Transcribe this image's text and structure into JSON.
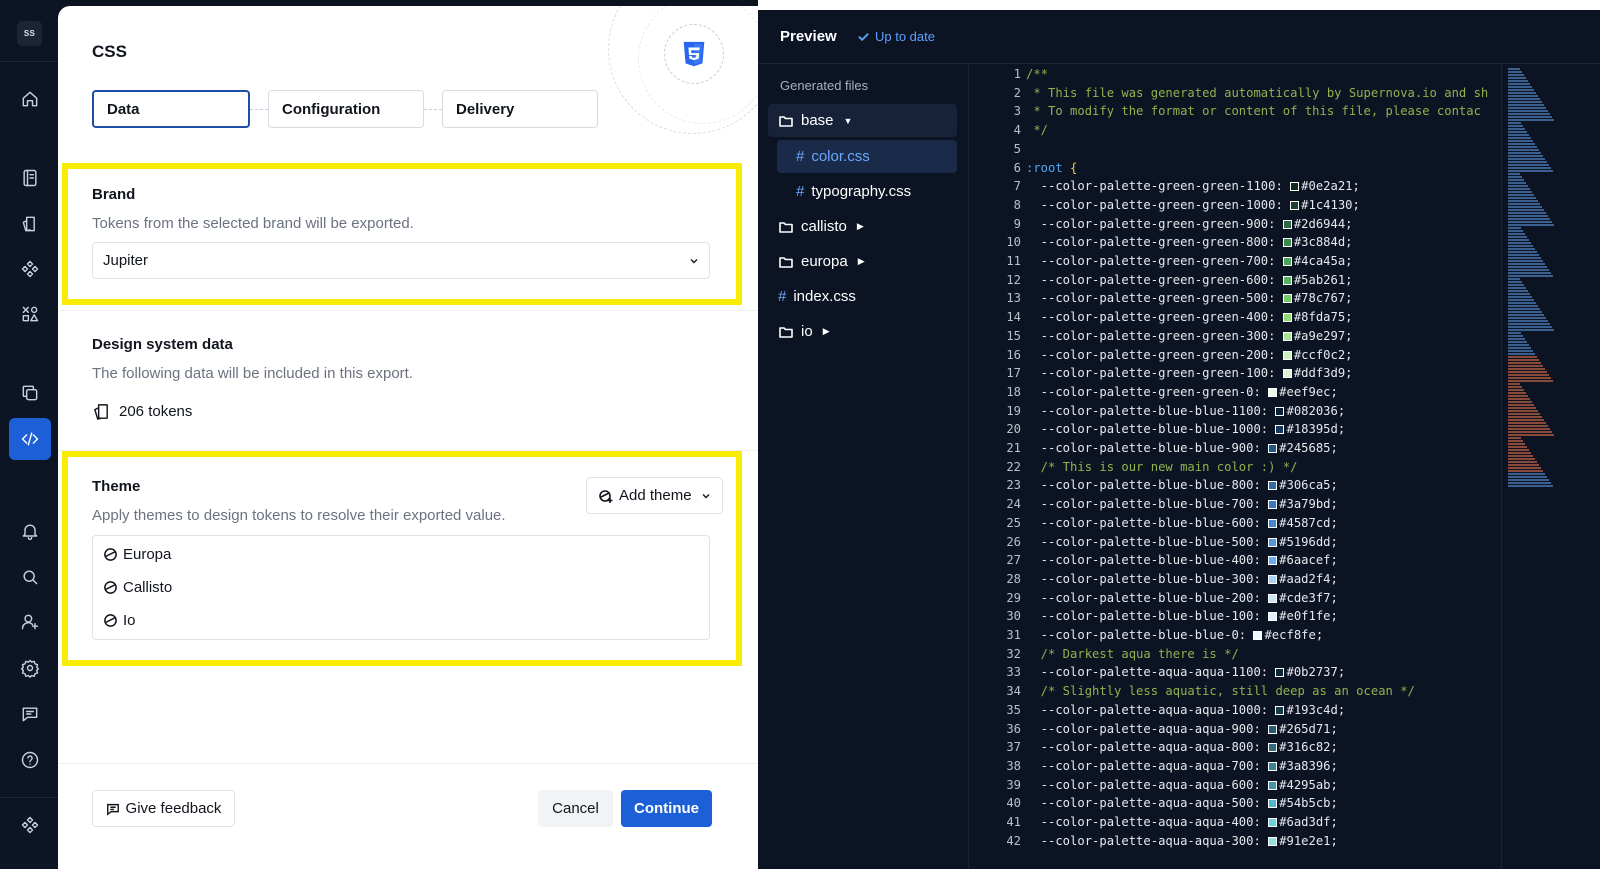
{
  "rail": {
    "logo": "SS",
    "items": [
      {
        "name": "home-icon",
        "icon": "home"
      },
      {
        "name": "book-icon",
        "icon": "book"
      },
      {
        "name": "documents-icon",
        "icon": "docs"
      },
      {
        "name": "components-icon",
        "icon": "component"
      },
      {
        "name": "assets-icon",
        "icon": "assets"
      },
      {
        "name": "copy-icon",
        "icon": "copy"
      },
      {
        "name": "code-icon",
        "icon": "code",
        "active": true
      },
      {
        "name": "bell-icon",
        "icon": "bell"
      },
      {
        "name": "search-icon",
        "icon": "search"
      },
      {
        "name": "add-user-icon",
        "icon": "adduser"
      },
      {
        "name": "gear-icon",
        "icon": "gear"
      },
      {
        "name": "chat-icon",
        "icon": "chat"
      },
      {
        "name": "help-icon",
        "icon": "help"
      },
      {
        "name": "supernova-icon",
        "icon": "supernova"
      }
    ]
  },
  "dialog": {
    "title": "CSS",
    "steps": [
      "Data",
      "Configuration",
      "Delivery"
    ],
    "brand": {
      "title": "Brand",
      "subtitle": "Tokens from the selected brand will be exported.",
      "selected": "Jupiter"
    },
    "design_data": {
      "title": "Design system data",
      "subtitle": "The following data will be included in this export.",
      "tokens": "206 tokens"
    },
    "theme": {
      "title": "Theme",
      "subtitle": "Apply themes to design tokens to resolve their exported value.",
      "add_label": "Add theme",
      "items": [
        "Europa",
        "Callisto",
        "Io"
      ]
    },
    "footer": {
      "feedback": "Give feedback",
      "cancel": "Cancel",
      "continue": "Continue"
    }
  },
  "preview": {
    "title": "Preview",
    "status": "Up to date",
    "generated_label": "Generated files",
    "tree": [
      {
        "label": "base",
        "type": "folder",
        "expanded": true
      },
      {
        "label": "color.css",
        "type": "file",
        "current": true
      },
      {
        "label": "typography.css",
        "type": "file"
      },
      {
        "label": "callisto",
        "type": "folder"
      },
      {
        "label": "europa",
        "type": "folder"
      },
      {
        "label": "index.css",
        "type": "file"
      },
      {
        "label": "io",
        "type": "folder"
      }
    ],
    "code_lines": [
      {
        "t": "c",
        "s": "/**"
      },
      {
        "t": "c",
        "s": " * This file was generated automatically by Supernova.io and sh"
      },
      {
        "t": "c",
        "s": " * To modify the format or content of this file, please contac"
      },
      {
        "t": "c",
        "s": " */"
      },
      {
        "t": "b",
        "s": ""
      },
      {
        "t": "r",
        "s": ":root {"
      },
      {
        "t": "v",
        "n": "--color-palette-green-green-1100",
        "v": "#0e2a21"
      },
      {
        "t": "v",
        "n": "--color-palette-green-green-1000",
        "v": "#1c4130"
      },
      {
        "t": "v",
        "n": "--color-palette-green-green-900",
        "v": "#2d6944"
      },
      {
        "t": "v",
        "n": "--color-palette-green-green-800",
        "v": "#3c884d"
      },
      {
        "t": "v",
        "n": "--color-palette-green-green-700",
        "v": "#4ca45a"
      },
      {
        "t": "v",
        "n": "--color-palette-green-green-600",
        "v": "#5ab261"
      },
      {
        "t": "v",
        "n": "--color-palette-green-green-500",
        "v": "#78c767"
      },
      {
        "t": "v",
        "n": "--color-palette-green-green-400",
        "v": "#8fda75"
      },
      {
        "t": "v",
        "n": "--color-palette-green-green-300",
        "v": "#a9e297"
      },
      {
        "t": "v",
        "n": "--color-palette-green-green-200",
        "v": "#ccf0c2"
      },
      {
        "t": "v",
        "n": "--color-palette-green-green-100",
        "v": "#ddf3d9"
      },
      {
        "t": "v",
        "n": "--color-palette-green-green-0",
        "v": "#eef9ec"
      },
      {
        "t": "v",
        "n": "--color-palette-blue-blue-1100",
        "v": "#082036"
      },
      {
        "t": "v",
        "n": "--color-palette-blue-blue-1000",
        "v": "#18395d"
      },
      {
        "t": "v",
        "n": "--color-palette-blue-blue-900",
        "v": "#245685"
      },
      {
        "t": "c2",
        "s": "/* This is our new main color :) */"
      },
      {
        "t": "v",
        "n": "--color-palette-blue-blue-800",
        "v": "#306ca5"
      },
      {
        "t": "v",
        "n": "--color-palette-blue-blue-700",
        "v": "#3a79bd"
      },
      {
        "t": "v",
        "n": "--color-palette-blue-blue-600",
        "v": "#4587cd"
      },
      {
        "t": "v",
        "n": "--color-palette-blue-blue-500",
        "v": "#5196dd"
      },
      {
        "t": "v",
        "n": "--color-palette-blue-blue-400",
        "v": "#6aacef"
      },
      {
        "t": "v",
        "n": "--color-palette-blue-blue-300",
        "v": "#aad2f4"
      },
      {
        "t": "v",
        "n": "--color-palette-blue-blue-200",
        "v": "#cde3f7"
      },
      {
        "t": "v",
        "n": "--color-palette-blue-blue-100",
        "v": "#e0f1fe"
      },
      {
        "t": "v",
        "n": "--color-palette-blue-blue-0",
        "v": "#ecf8fe"
      },
      {
        "t": "c2",
        "s": "/* Darkest aqua there is */"
      },
      {
        "t": "v",
        "n": "--color-palette-aqua-aqua-1100",
        "v": "#0b2737"
      },
      {
        "t": "c2",
        "s": "/* Slightly less aquatic, still deep as an ocean */"
      },
      {
        "t": "v",
        "n": "--color-palette-aqua-aqua-1000",
        "v": "#193c4d"
      },
      {
        "t": "v",
        "n": "--color-palette-aqua-aqua-900",
        "v": "#265d71"
      },
      {
        "t": "v",
        "n": "--color-palette-aqua-aqua-800",
        "v": "#316c82"
      },
      {
        "t": "v",
        "n": "--color-palette-aqua-aqua-700",
        "v": "#3a8396"
      },
      {
        "t": "v",
        "n": "--color-palette-aqua-aqua-600",
        "v": "#4295ab"
      },
      {
        "t": "v",
        "n": "--color-palette-aqua-aqua-500",
        "v": "#54b5cb"
      },
      {
        "t": "v",
        "n": "--color-palette-aqua-aqua-400",
        "v": "#6ad3df"
      },
      {
        "t": "v",
        "n": "--color-palette-aqua-aqua-300",
        "v": "#91e2e1"
      }
    ]
  }
}
